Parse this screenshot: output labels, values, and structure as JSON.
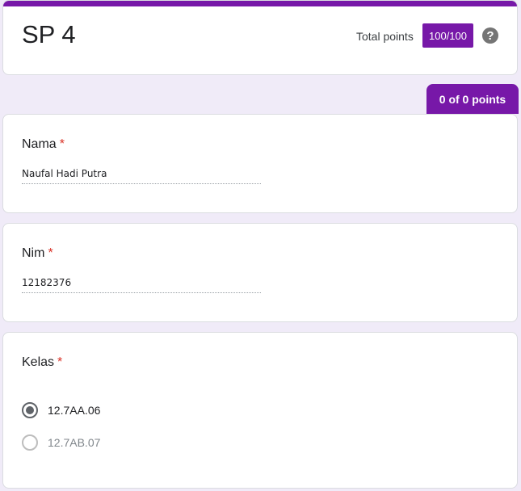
{
  "header": {
    "title": "SP 4",
    "total_points_label": "Total points",
    "total_points_value": "100/100",
    "help_icon": "help-circle-icon",
    "accent_color": "#7718a8"
  },
  "section": {
    "score": "0 of 0 points"
  },
  "questions": [
    {
      "title": "Nama",
      "required_mark": "*",
      "answer": "Naufal Hadi Putra"
    },
    {
      "title": "Nim",
      "required_mark": "*",
      "answer": "12182376"
    },
    {
      "title": "Kelas",
      "required_mark": "*",
      "options": [
        {
          "label": "12.7AA.06",
          "selected": true
        },
        {
          "label": "12.7AB.07",
          "selected": false
        }
      ]
    }
  ]
}
